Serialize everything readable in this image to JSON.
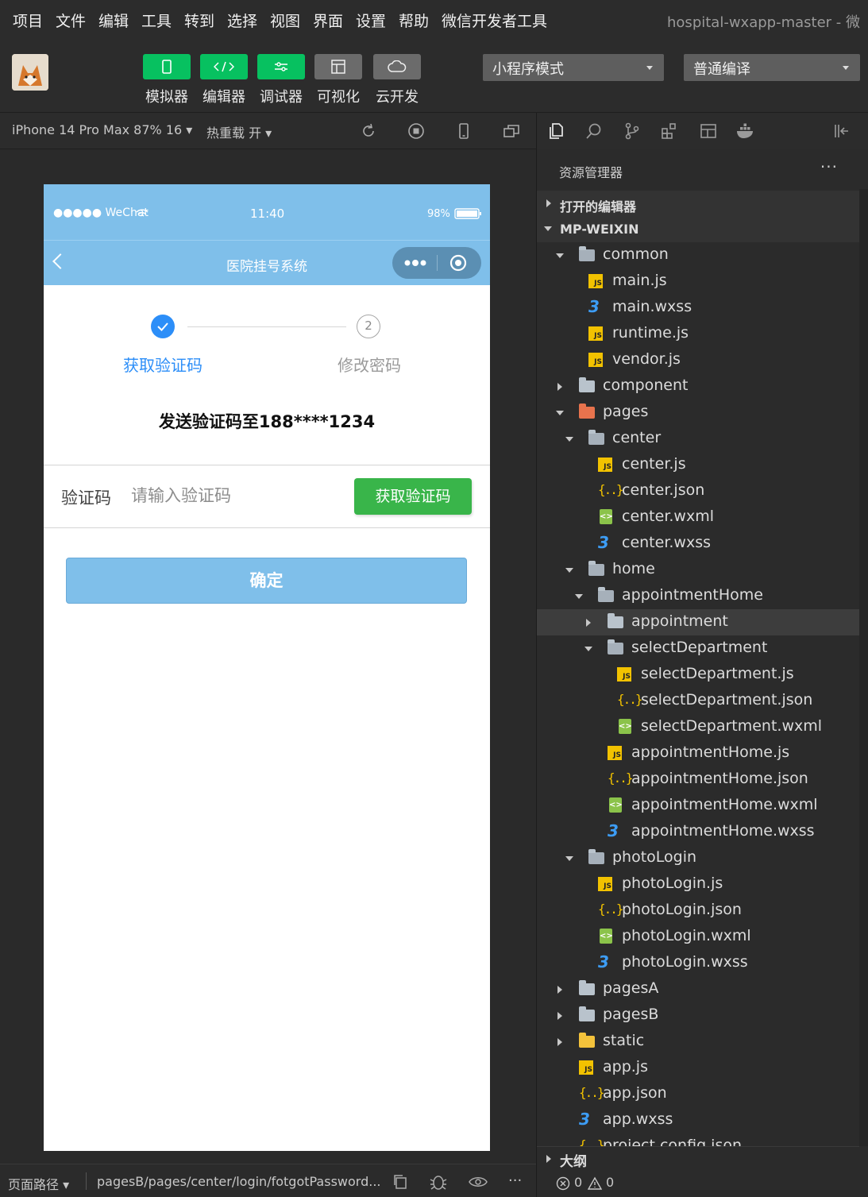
{
  "menu": [
    "项目",
    "文件",
    "编辑",
    "工具",
    "转到",
    "选择",
    "视图",
    "界面",
    "设置",
    "帮助",
    "微信开发者工具"
  ],
  "window_title": "hospital-wxapp-master - 微",
  "toolbar": {
    "buttons": [
      {
        "label": "模拟器",
        "icon": "phone-icon",
        "active": true
      },
      {
        "label": "编辑器",
        "icon": "code-icon",
        "active": true
      },
      {
        "label": "调试器",
        "icon": "sliders-icon",
        "active": true
      },
      {
        "label": "可视化",
        "icon": "layout-icon",
        "active": false
      },
      {
        "label": "云开发",
        "icon": "cloud-icon",
        "active": false
      }
    ],
    "mode_select": "小程序模式",
    "compile_select": "普通编译"
  },
  "simulator_bar": {
    "device": "iPhone 14 Pro Max 87% 16 ▾",
    "hot_reload": "热重载 开 ▾"
  },
  "phone": {
    "status": {
      "carrier": "●●●●● WeChat",
      "time": "11:40",
      "battery": "98%"
    },
    "nav_title": "医院挂号系统",
    "steps": [
      {
        "label": "获取验证码",
        "state": "done"
      },
      {
        "label": "修改密码",
        "number": "2",
        "state": "todo"
      }
    ],
    "send_text": "发送验证码至188****1234",
    "code_label": "验证码",
    "code_placeholder": "请输入验证码",
    "get_code_button": "获取验证码",
    "confirm_button": "确定",
    "colors": {
      "theme": "#7fbfea",
      "step_active": "#2c8ef8",
      "green_button": "#39b54a"
    }
  },
  "explorer": {
    "title": "资源管理器",
    "more": "···",
    "sections": {
      "open_editors": "打开的编辑器",
      "project": "MP-WEIXIN",
      "outline": "大纲"
    },
    "tree": [
      {
        "name": "common",
        "type": "folder",
        "open": true,
        "depth": 0
      },
      {
        "name": "main.js",
        "type": "js",
        "depth": 1
      },
      {
        "name": "main.wxss",
        "type": "wxss",
        "depth": 1
      },
      {
        "name": "runtime.js",
        "type": "js",
        "depth": 1
      },
      {
        "name": "vendor.js",
        "type": "js",
        "depth": 1
      },
      {
        "name": "component",
        "type": "folder",
        "open": false,
        "depth": 0
      },
      {
        "name": "pages",
        "type": "pages",
        "open": true,
        "depth": 0
      },
      {
        "name": "center",
        "type": "folder",
        "open": true,
        "depth": 1
      },
      {
        "name": "center.js",
        "type": "js",
        "depth": 2
      },
      {
        "name": "center.json",
        "type": "json",
        "depth": 2
      },
      {
        "name": "center.wxml",
        "type": "wxml",
        "depth": 2
      },
      {
        "name": "center.wxss",
        "type": "wxss",
        "depth": 2
      },
      {
        "name": "home",
        "type": "folder",
        "open": true,
        "depth": 1
      },
      {
        "name": "appointmentHome",
        "type": "folder",
        "open": true,
        "depth": 2
      },
      {
        "name": "appointment",
        "type": "folder",
        "open": false,
        "depth": 3,
        "selected": true
      },
      {
        "name": "selectDepartment",
        "type": "folder",
        "open": true,
        "depth": 3
      },
      {
        "name": "selectDepartment.js",
        "type": "js",
        "depth": 4
      },
      {
        "name": "selectDepartment.json",
        "type": "json",
        "depth": 4
      },
      {
        "name": "selectDepartment.wxml",
        "type": "wxml",
        "depth": 4
      },
      {
        "name": "appointmentHome.js",
        "type": "js",
        "depth": 3
      },
      {
        "name": "appointmentHome.json",
        "type": "json",
        "depth": 3
      },
      {
        "name": "appointmentHome.wxml",
        "type": "wxml",
        "depth": 3
      },
      {
        "name": "appointmentHome.wxss",
        "type": "wxss",
        "depth": 3
      },
      {
        "name": "photoLogin",
        "type": "folder",
        "open": true,
        "depth": 1
      },
      {
        "name": "photoLogin.js",
        "type": "js",
        "depth": 2
      },
      {
        "name": "photoLogin.json",
        "type": "json",
        "depth": 2
      },
      {
        "name": "photoLogin.wxml",
        "type": "wxml",
        "depth": 2
      },
      {
        "name": "photoLogin.wxss",
        "type": "wxss",
        "depth": 2
      },
      {
        "name": "pagesA",
        "type": "folder",
        "open": false,
        "depth": 0
      },
      {
        "name": "pagesB",
        "type": "folder",
        "open": false,
        "depth": 0
      },
      {
        "name": "static",
        "type": "static",
        "open": false,
        "depth": 0
      },
      {
        "name": "app.js",
        "type": "js",
        "depth": 0
      },
      {
        "name": "app.json",
        "type": "json",
        "depth": 0
      },
      {
        "name": "app.wxss",
        "type": "wxss",
        "depth": 0
      },
      {
        "name": "project.config.json",
        "type": "json",
        "depth": 0
      }
    ]
  },
  "bottom_bar": {
    "path_label": "页面路径 ▾",
    "path": "pagesB/pages/center/login/fotgotPassword..."
  },
  "problems": {
    "errors": "0",
    "warnings": "0"
  }
}
